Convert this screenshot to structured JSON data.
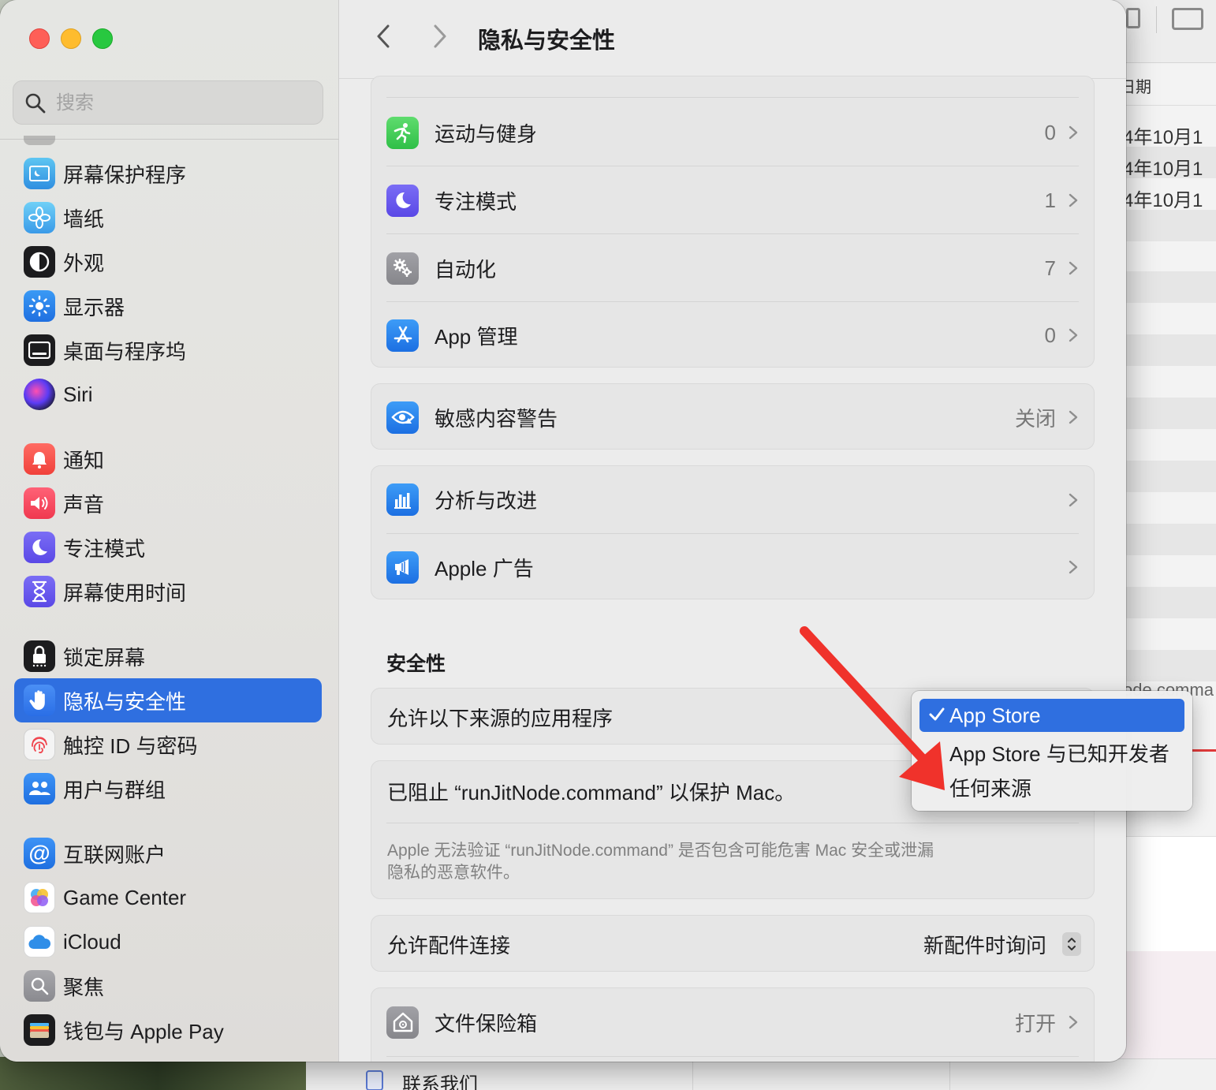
{
  "window": {
    "title": "隐私与安全性"
  },
  "sidebar": {
    "search_placeholder": "搜索",
    "items": [
      {
        "label": "屏幕保护程序",
        "icon": "screensaver-icon"
      },
      {
        "label": "墙纸",
        "icon": "wallpaper-icon"
      },
      {
        "label": "外观",
        "icon": "appearance-icon"
      },
      {
        "label": "显示器",
        "icon": "displays-icon"
      },
      {
        "label": "桌面与程序坞",
        "icon": "desktop-dock-icon"
      },
      {
        "label": "Siri",
        "icon": "siri-icon"
      },
      {
        "label": "通知",
        "icon": "notifications-icon"
      },
      {
        "label": "声音",
        "icon": "sound-icon"
      },
      {
        "label": "专注模式",
        "icon": "focus-icon"
      },
      {
        "label": "屏幕使用时间",
        "icon": "screen-time-icon"
      },
      {
        "label": "锁定屏幕",
        "icon": "lock-screen-icon"
      },
      {
        "label": "隐私与安全性",
        "icon": "privacy-hand-icon",
        "selected": true
      },
      {
        "label": "触控 ID 与密码",
        "icon": "touch-id-icon"
      },
      {
        "label": "用户与群组",
        "icon": "users-groups-icon"
      },
      {
        "label": "互联网账户",
        "icon": "internet-accounts-icon"
      },
      {
        "label": "Game Center",
        "icon": "game-center-icon"
      },
      {
        "label": "iCloud",
        "icon": "icloud-icon"
      },
      {
        "label": "聚焦",
        "icon": "spotlight-icon"
      },
      {
        "label": "钱包与 Apple Pay",
        "icon": "wallet-icon"
      }
    ]
  },
  "privacy_rows": [
    {
      "label": "运动与健身",
      "value": "0",
      "icon": "fitness-icon"
    },
    {
      "label": "专注模式",
      "value": "1",
      "icon": "focus-icon"
    },
    {
      "label": "自动化",
      "value": "7",
      "icon": "automation-gears-icon"
    },
    {
      "label": "App 管理",
      "value": "0",
      "icon": "app-store-icon"
    }
  ],
  "sensitive": {
    "label": "敏感内容警告",
    "value": "关闭"
  },
  "analytics": [
    {
      "label": "分析与改进"
    },
    {
      "label": "Apple 广告"
    }
  ],
  "security": {
    "section_title": "安全性",
    "allow_apps_label": "允许以下来源的应用程序",
    "blocked_label": "已阻止 “runJitNode.command” 以保护 Mac。",
    "blocked_desc_line1": "Apple 无法验证 “runJitNode.command” 是否包含可能危害 Mac 安全或泄漏",
    "blocked_desc_line2": "隐私的恶意软件。",
    "accessory_label": "允许配件连接",
    "accessory_value": "新配件时询问",
    "filevault_label": "文件保险箱",
    "filevault_value": "打开"
  },
  "popup": {
    "options": [
      "App Store",
      "App Store 与已知开发者",
      "任何来源"
    ],
    "selected": "App Store"
  },
  "background": {
    "header": "日期",
    "dates": [
      "4年10月1",
      "4年10月1",
      "4年10月1"
    ],
    "partial_text": "ode comma",
    "bottom_item": "联系我们"
  },
  "colors": {
    "accent": "#2f6fe0",
    "annotation_arrow": "#f0322b"
  }
}
